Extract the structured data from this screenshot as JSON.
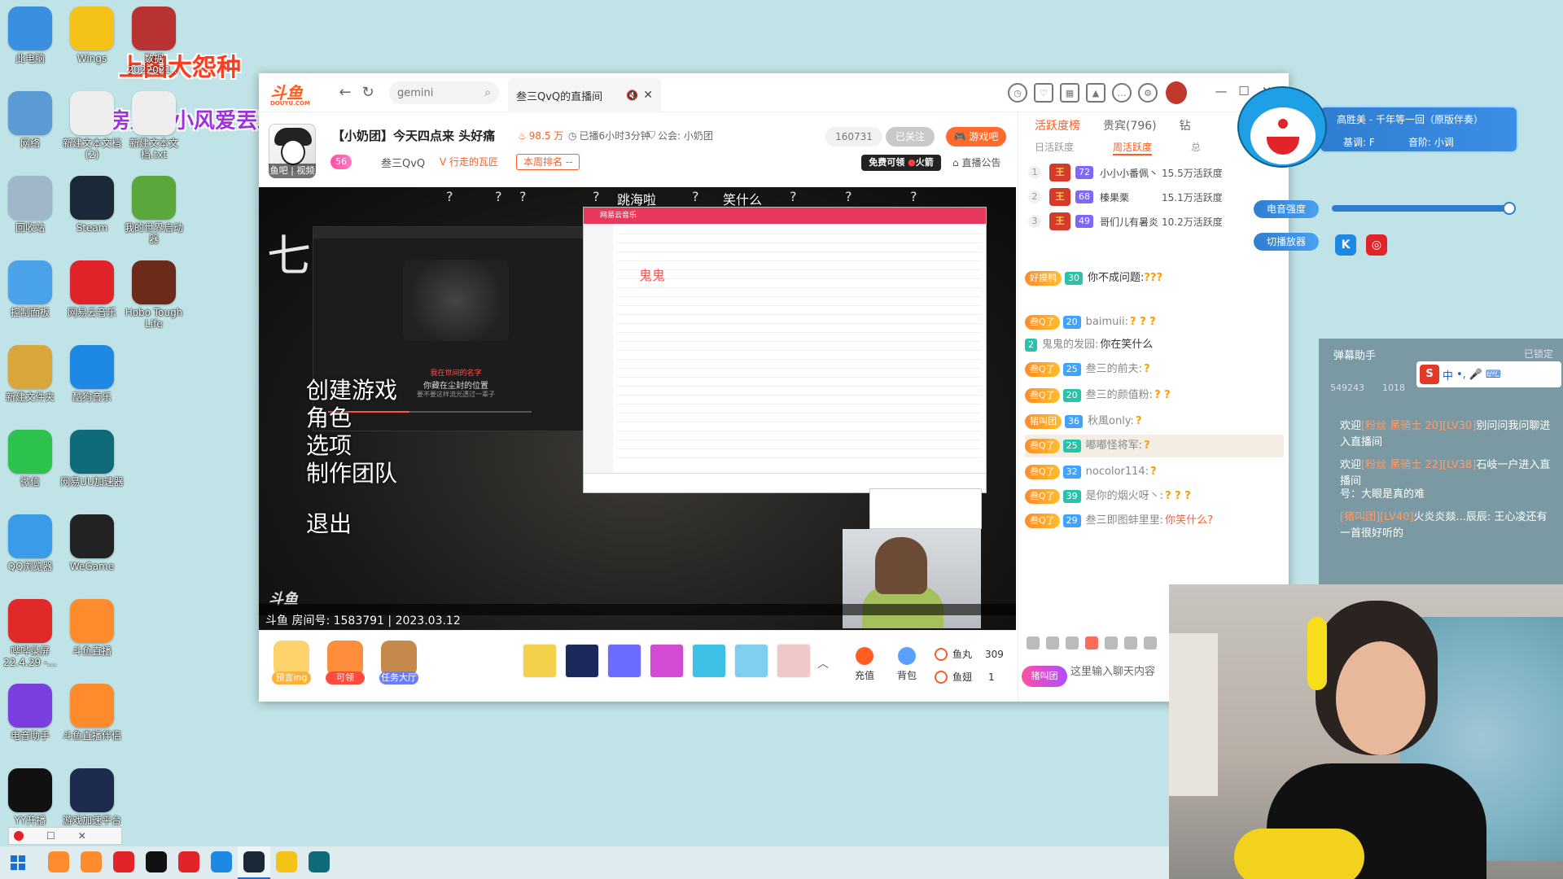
{
  "desktop": {
    "overlay_title": "上图大怨种",
    "overlay_subtitle": "温房里的小风爱丟工",
    "icons_col1": [
      {
        "label": "此电脑"
      },
      {
        "label": "网络"
      },
      {
        "label": "回收站"
      },
      {
        "label": "控制面板"
      },
      {
        "label": "新建文件夹"
      },
      {
        "label": "微信"
      },
      {
        "label": "QQ浏览器"
      },
      {
        "label": "哔哔录屏 22.4.29 -..."
      },
      {
        "label": "电音助手"
      },
      {
        "label": "YY开播"
      }
    ],
    "icons_col2": [
      {
        "label": "Wings"
      },
      {
        "label": "新建文本文档 (2)"
      },
      {
        "label": "Steam"
      },
      {
        "label": "网易云音乐"
      },
      {
        "label": "酷狗音乐"
      },
      {
        "label": "网易UU加速器"
      },
      {
        "label": "WeGame"
      },
      {
        "label": "斗鱼直播"
      },
      {
        "label": "斗鱼直播伴侣"
      },
      {
        "label": "游戏加速平台"
      }
    ],
    "icons_col3": [
      {
        "label": "数据2022021..."
      },
      {
        "label": "新建文本文档.txt"
      },
      {
        "label": "我的世界启动器"
      },
      {
        "label": "Hobo Tough Life"
      }
    ]
  },
  "browser": {
    "brand": "斗鱼",
    "brand_sub": "DOUYU.COM",
    "search_placeholder": "gemini",
    "tab_title": "叁三QvQ的直播间",
    "tab_mute": "🔇",
    "tab_close": "✕"
  },
  "room": {
    "title": "【小奶团】今天四点来 头好痛",
    "hot": "98.5 万",
    "duration": "已播6小时3分钟",
    "guild": "公会: 小奶团",
    "level": "56",
    "anchor": "叁三QvQ",
    "tag": "行走的瓦匠",
    "rank_label": "本周排名 --",
    "follow_count": "160731",
    "follow_label": "已关注",
    "game_label": "游戏吧",
    "promo": "免费可领",
    "promo_suffix": "火箭",
    "announcement": "直播公告",
    "video_tag": "鱼吧 | 视频"
  },
  "video": {
    "top_texts": [
      "跳海啦",
      "笑什么"
    ],
    "menu_items": [
      "创建游戏",
      "角色",
      "选项",
      "制作团队"
    ],
    "exit": "退出",
    "lyric_red": "我在世间的名字",
    "lyric_main": "你藏在尘封的位置",
    "lyric_sub": "要不要这样流光透过一辈子",
    "ghost_text": "鬼鬼",
    "room_info": "斗鱼 房间号: 1583791 | 2023.03.12",
    "watermark": "斗鱼"
  },
  "toolbar": {
    "tools": [
      {
        "label": "预言ing"
      },
      {
        "label": "可领"
      },
      {
        "label": "任务大厅"
      }
    ],
    "recharge": "充值",
    "backpack": "背包",
    "fish_ball_label": "鱼丸",
    "fish_ball_value": "309",
    "fish_fin_label": "鱼翅",
    "fish_fin_value": "1"
  },
  "chat": {
    "tabs": [
      "活跃度榜",
      "贵宾(796)",
      "钻"
    ],
    "sub_tabs": [
      "日活跃度",
      "周活跃度",
      "总"
    ],
    "ranks": [
      {
        "num": "1",
        "level": "72",
        "name": "小小小番佩丶",
        "score": "15.5万活跃度"
      },
      {
        "num": "2",
        "level": "68",
        "name": "榛果栗",
        "score": "15.1万活跃度"
      },
      {
        "num": "3",
        "level": "49",
        "name": "哥们儿有暑炎",
        "score": "10.2万活跃度"
      }
    ],
    "messages": [
      {
        "badge": "好摸鸭",
        "lv": "30",
        "user": "",
        "text": "你不成问题:",
        "q": "???"
      },
      {
        "badge": "叁Q了",
        "lv": "20",
        "user": "baimuii:",
        "text": "",
        "q": "? ? ?"
      },
      {
        "badge": "",
        "lv": "2",
        "user": "鬼鬼的发园:",
        "text": "你在笑什么",
        "q": ""
      },
      {
        "badge": "叁Q了",
        "lv": "25",
        "user": "叁三的前夫:",
        "text": "",
        "q": "?"
      },
      {
        "badge": "叁Q了",
        "lv": "20",
        "user": "叁三的颜值粉:",
        "text": "",
        "q": "? ?"
      },
      {
        "badge": "猪叫团",
        "lv": "36",
        "user": "秋風only:",
        "text": "",
        "q": "?"
      },
      {
        "badge": "叁Q了",
        "lv": "25",
        "user": "嘟嘟怪将军:",
        "text": "",
        "q": "?"
      },
      {
        "badge": "叁Q了",
        "lv": "32",
        "user": "nocolor114:",
        "text": "",
        "q": "?"
      },
      {
        "badge": "叁Q了",
        "lv": "39",
        "user": "是你的烟火呀丶:",
        "text": "",
        "q": "? ? ?"
      },
      {
        "badge": "叁Q了",
        "lv": "29",
        "user": "叁三即图蚌里里:",
        "text": "你笑什么?",
        "q": ""
      }
    ],
    "input_placeholder": "这里输入聊天内容",
    "input_badge": "猪叫团"
  },
  "music_widget": {
    "song": "高胜美 - 千年等一回（原版伴奏）",
    "key": "基调: F",
    "pitch": "音阶: 小调",
    "label_intensity": "电音强度",
    "label_player": "切播放器",
    "intensity": 0.97
  },
  "danmaku": {
    "title": "弹幕助手",
    "lock": "已锁定",
    "ime_text": "中",
    "stats": "549243",
    "stats2": "1018",
    "messages": [
      {
        "pre": "欢迎",
        "name": "[粉丝 黑骑士 20][LV30]",
        "post": "别问问我问聊进入直播间"
      },
      {
        "pre": "欢迎",
        "name": "[粉丝 黑骑士 22][LV38]",
        "post": "石岐一户进入直播间"
      },
      {
        "pre": "号：",
        "name": "",
        "post": "大眼是真的难"
      },
      {
        "pre": "",
        "name": "[猪叫团][LV40]",
        "post": "火炎炎燚...辰辰: 王心凌还有一首很好听的"
      }
    ]
  },
  "taskbar": {
    "apps": [
      "douyu",
      "douyu2",
      "recorder",
      "yy",
      "netease",
      "kugou",
      "steam",
      "wings",
      "uu"
    ],
    "float_tab_close": "✕",
    "float_tab_max": "☐"
  },
  "colors": {
    "accent": "#ff5d23",
    "desktop_bg": "#bfe3e6",
    "chat_orange": "#ff9c00"
  }
}
